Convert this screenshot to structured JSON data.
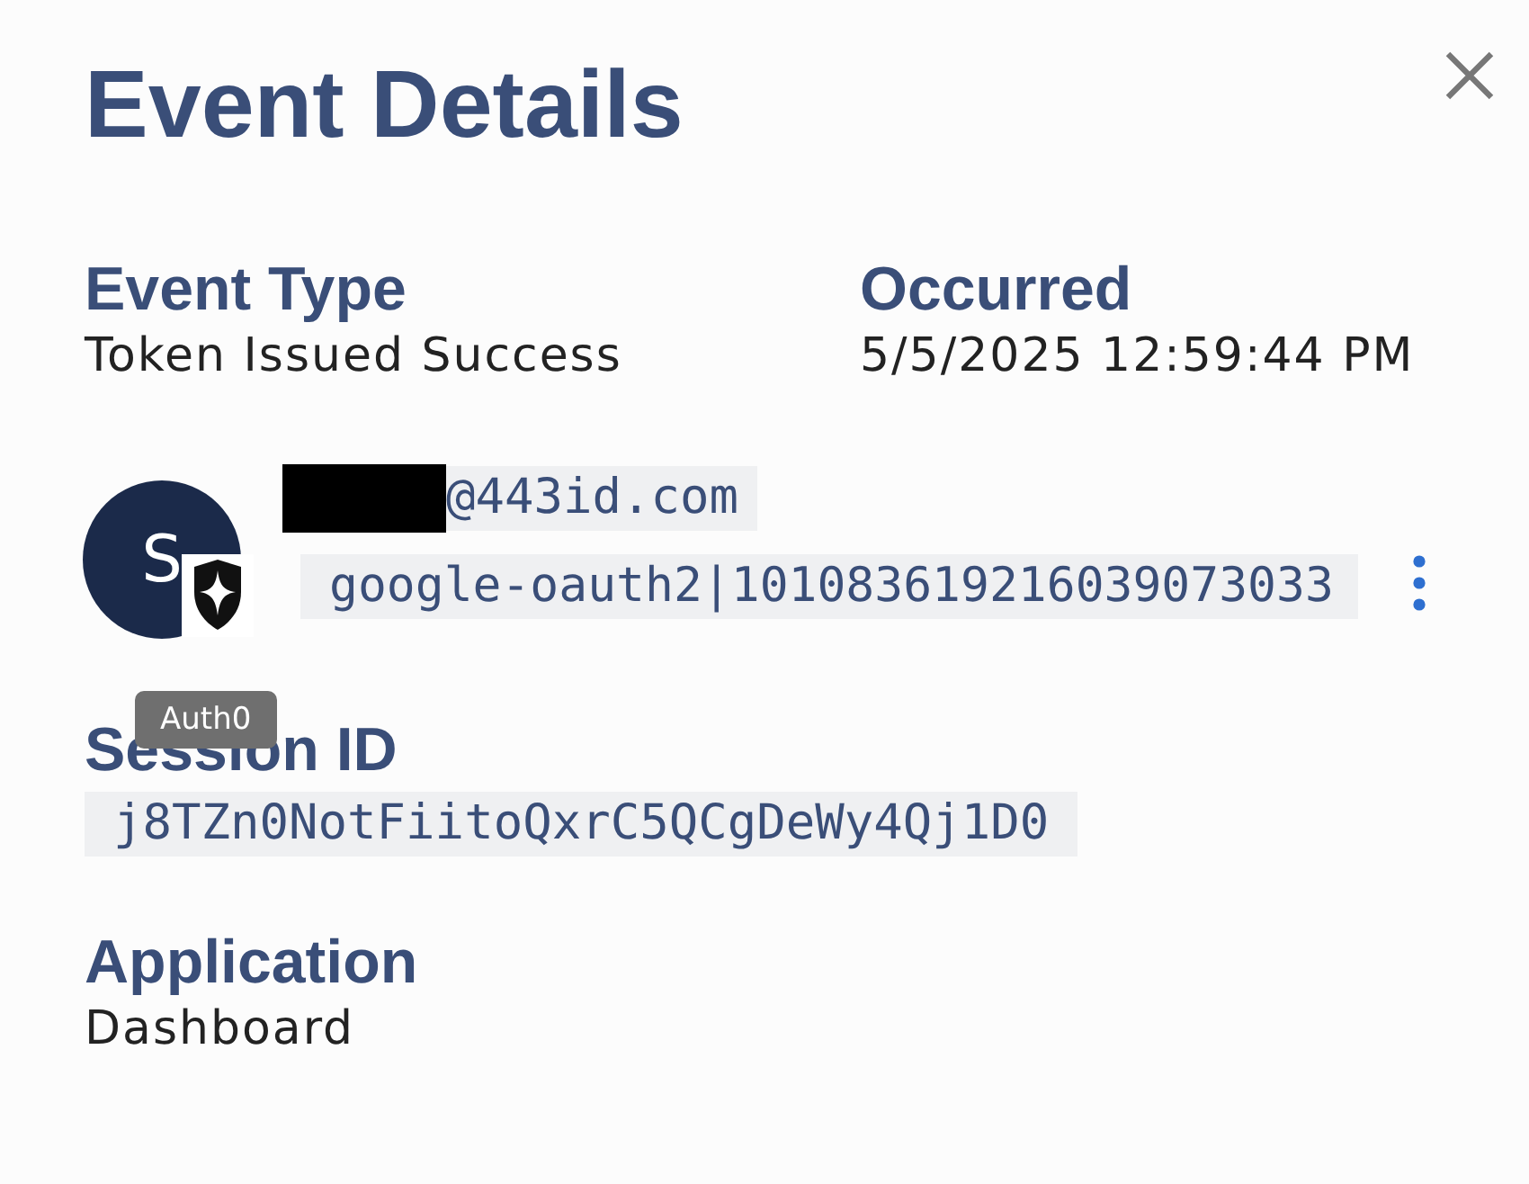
{
  "panel": {
    "title": "Event Details"
  },
  "fields": [
    {
      "label": "Event Type",
      "value": "Token Issued Success"
    },
    {
      "label": "Occurred",
      "value": "5/5/2025 12:59:44 PM"
    }
  ],
  "user": {
    "avatar_letter": "S",
    "email": "@443id.com",
    "user_id": "google-oauth2|101083619216039073033",
    "badge_tooltip": "Auth0"
  },
  "session": {
    "label": "Session ID",
    "value": "j8TZn0NotFiitoQxrC5QCgDeWy4Qj1D0"
  },
  "application": {
    "label": "Application",
    "value": "Dashboard"
  }
}
